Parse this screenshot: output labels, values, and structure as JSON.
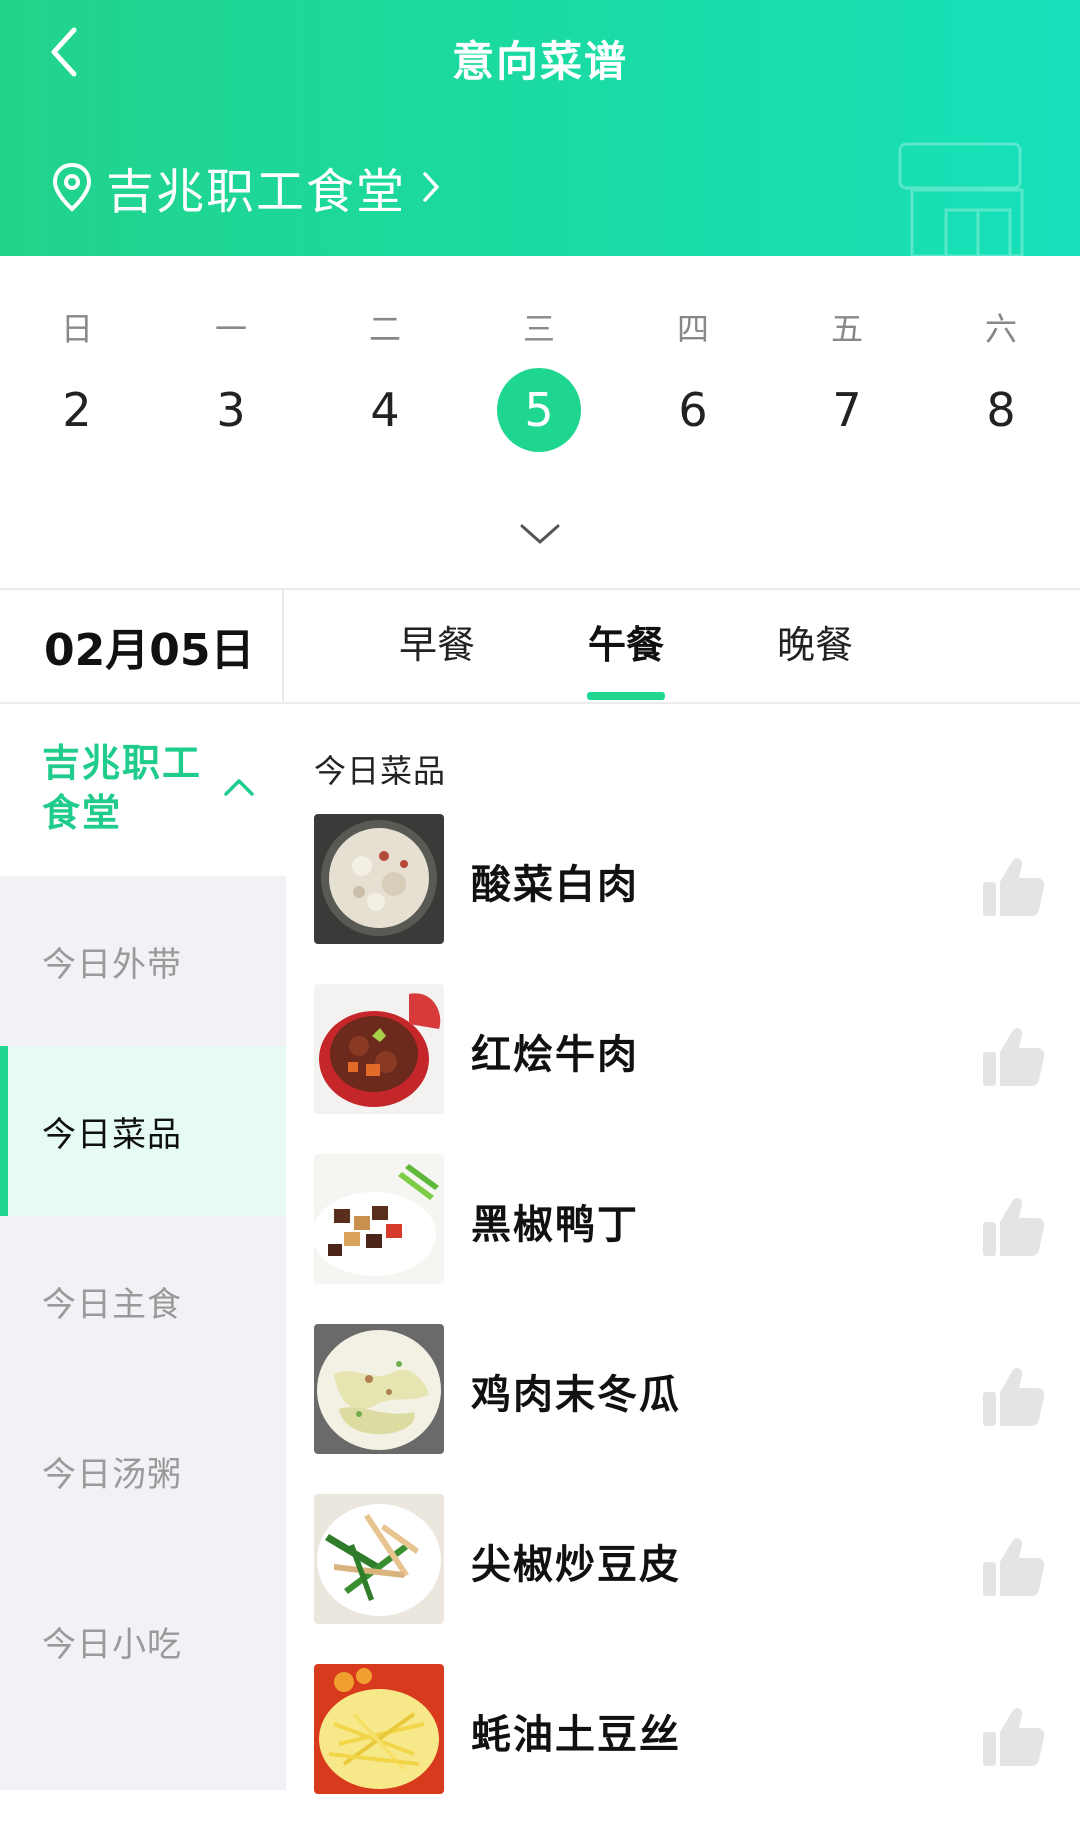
{
  "header": {
    "title": "意向菜谱",
    "location_label": "吉兆职工食堂",
    "background_color": "#1fd89e"
  },
  "calendar": {
    "days": [
      {
        "weekday": "日",
        "date": "2"
      },
      {
        "weekday": "一",
        "date": "3"
      },
      {
        "weekday": "二",
        "date": "4"
      },
      {
        "weekday": "三",
        "date": "5"
      },
      {
        "weekday": "四",
        "date": "6"
      },
      {
        "weekday": "五",
        "date": "7"
      },
      {
        "weekday": "六",
        "date": "8"
      }
    ],
    "selected_date": "5",
    "accent_color": "#1fd690"
  },
  "meal_bar": {
    "date_label": "02月05日",
    "tabs": [
      {
        "label": "早餐"
      },
      {
        "label": "午餐"
      },
      {
        "label": "晚餐"
      }
    ],
    "active_tab": "午餐"
  },
  "sidebar": {
    "canteen_label": "吉兆职工食堂",
    "items": [
      {
        "label": "今日外带"
      },
      {
        "label": "今日菜品"
      },
      {
        "label": "今日主食"
      },
      {
        "label": "今日汤粥"
      },
      {
        "label": "今日小吃"
      }
    ],
    "active_item": "今日菜品"
  },
  "dishes": {
    "section_title": "今日菜品",
    "items": [
      {
        "name": "酸菜白肉",
        "icon": "thumbs-up-icon"
      },
      {
        "name": "红烩牛肉",
        "icon": "thumbs-up-icon"
      },
      {
        "name": "黑椒鸭丁",
        "icon": "thumbs-up-icon"
      },
      {
        "name": "鸡肉末冬瓜",
        "icon": "thumbs-up-icon"
      },
      {
        "name": "尖椒炒豆皮",
        "icon": "thumbs-up-icon"
      },
      {
        "name": "蚝油土豆丝",
        "icon": "thumbs-up-icon"
      }
    ]
  },
  "icons": {
    "back": "chevron-left-icon",
    "location": "map-pin-icon",
    "location_arrow": "chevron-right-icon",
    "expand": "chevron-down-icon",
    "collapse": "chevron-up-icon",
    "like": "thumbs-up-icon"
  }
}
